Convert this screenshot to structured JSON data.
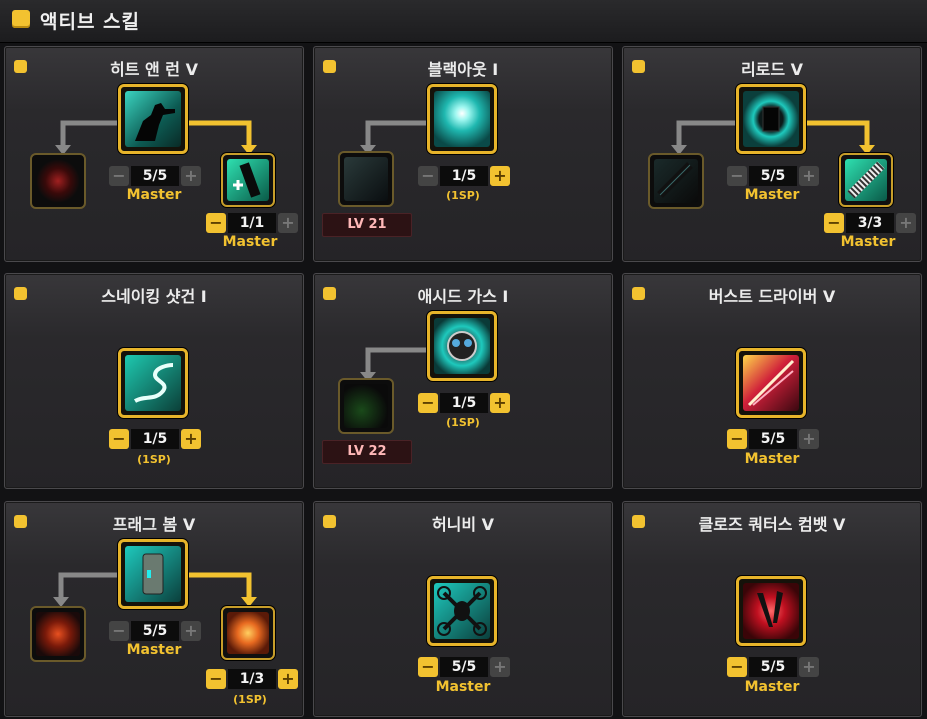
{
  "header": {
    "title": "액티브 스킬"
  },
  "skills": [
    {
      "name": "히트 앤 런 V",
      "level": "5/5",
      "tag": "Master",
      "sub_level": "1/1",
      "sub_tag": "Master"
    },
    {
      "name": "블랙아웃 I",
      "level": "1/5",
      "tag": "(1SP)",
      "locked_level": "LV 21"
    },
    {
      "name": "리로드 V",
      "level": "5/5",
      "tag": "Master",
      "sub_level": "3/3",
      "sub_tag": "Master"
    },
    {
      "name": "스네이킹 샷건 I",
      "level": "1/5",
      "tag": "(1SP)"
    },
    {
      "name": "애시드 가스 I",
      "level": "1/5",
      "tag": "(1SP)",
      "locked_level": "LV 22"
    },
    {
      "name": "버스트 드라이버 V",
      "level": "5/5",
      "tag": "Master"
    },
    {
      "name": "프래그 봄 V",
      "level": "5/5",
      "tag": "Master",
      "sub_level": "1/3",
      "sub_tag": "(1SP)"
    },
    {
      "name": "허니비 V",
      "level": "5/5",
      "tag": "Master"
    },
    {
      "name": "클로즈 쿼터스 컴뱃 V",
      "level": "5/5",
      "tag": "Master"
    }
  ],
  "colors": {
    "accent": "#f2c230",
    "panel": "#2a292c",
    "background": "#121214"
  }
}
